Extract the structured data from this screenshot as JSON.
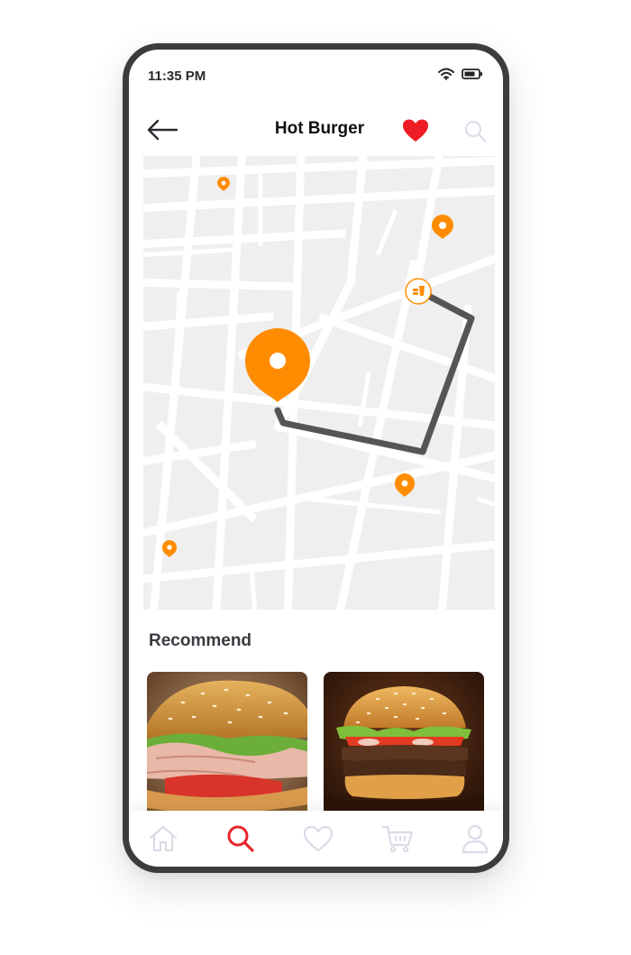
{
  "status": {
    "time": "11:35 PM"
  },
  "header": {
    "title": "Hot Burger"
  },
  "sections": {
    "recommend_title": "Recommend"
  },
  "recommend": {
    "items": [
      {
        "icon": "ham-sandwich-photo"
      },
      {
        "icon": "cheeseburger-photo"
      }
    ]
  },
  "tabs": [
    {
      "icon": "home-icon",
      "active": false
    },
    {
      "icon": "search-icon",
      "active": true
    },
    {
      "icon": "heart-icon",
      "active": false
    },
    {
      "icon": "cart-icon",
      "active": false
    },
    {
      "icon": "profile-icon",
      "active": false
    }
  ],
  "colors": {
    "accent": "#ff8c00",
    "active_tab": "#e8252b",
    "heart": "#ee1c25",
    "inactive": "#dadbe6",
    "route": "#555555",
    "map_bg": "#efefef"
  }
}
